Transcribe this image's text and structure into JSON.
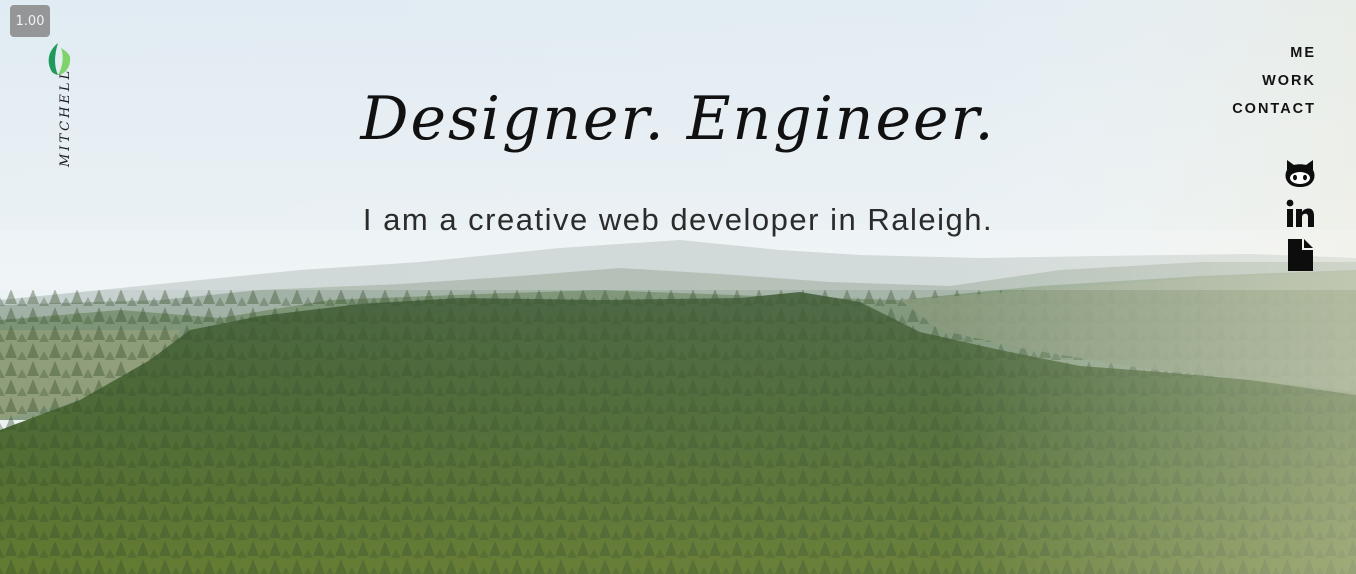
{
  "zoom": "1.00",
  "brand": {
    "name": "MITCHELL",
    "logo_icon": "leaf-icon"
  },
  "hero": {
    "headline": "Designer. Engineer.",
    "subline": "I am a creative web developer in Raleigh.",
    "background": "forest-aerial-image"
  },
  "nav": {
    "items": [
      "ME",
      "WORK",
      "CONTACT"
    ]
  },
  "social": [
    {
      "icon": "github-icon"
    },
    {
      "icon": "linkedin-icon"
    },
    {
      "icon": "document-icon"
    }
  ],
  "colors": {
    "text": "#111111",
    "leaf_light": "#7fd36a",
    "leaf_dark": "#1f9a5a"
  }
}
